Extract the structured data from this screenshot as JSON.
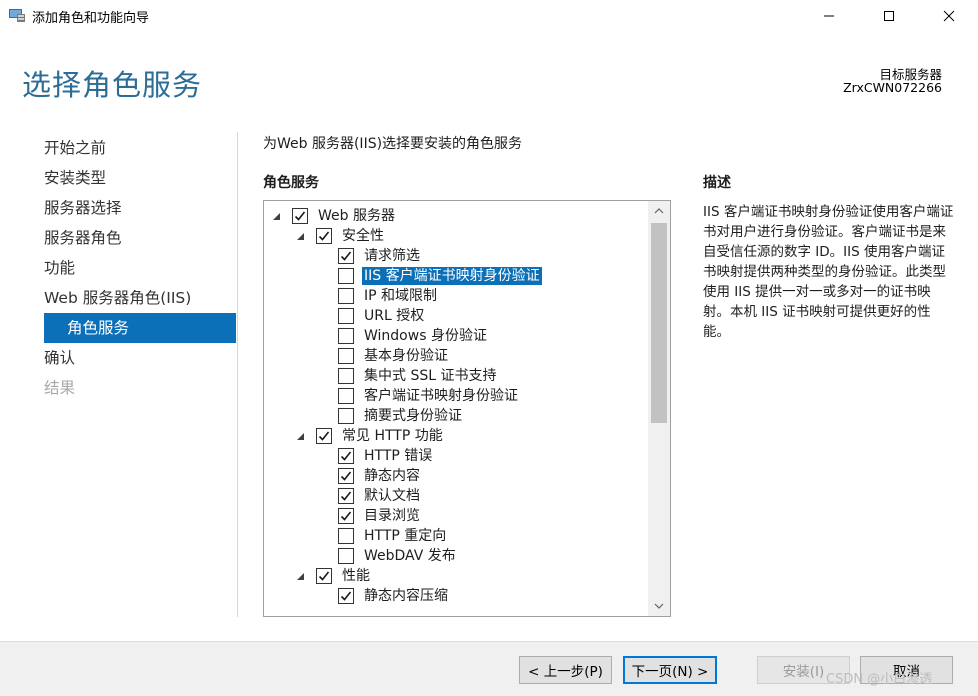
{
  "window": {
    "title": "添加角色和功能向导",
    "icons": {
      "app": "server-manager-icon",
      "minimize": "minimize-icon",
      "maximize": "maximize-icon",
      "close": "close-icon"
    }
  },
  "header": {
    "page_title": "选择角色服务",
    "destination_label": "目标服务器",
    "destination_server": "ZrxCWN072266"
  },
  "nav": {
    "items": [
      {
        "label": "开始之前",
        "state": "normal"
      },
      {
        "label": "安装类型",
        "state": "normal"
      },
      {
        "label": "服务器选择",
        "state": "normal"
      },
      {
        "label": "服务器角色",
        "state": "normal"
      },
      {
        "label": "功能",
        "state": "normal"
      },
      {
        "label": "Web 服务器角色(IIS)",
        "state": "normal"
      },
      {
        "label": "角色服务",
        "state": "active"
      },
      {
        "label": "确认",
        "state": "normal"
      },
      {
        "label": "结果",
        "state": "disabled"
      }
    ]
  },
  "content": {
    "instruction": "为Web 服务器(IIS)选择要安装的角色服务",
    "section_heading": "角色服务",
    "tree": [
      {
        "label": "Web 服务器",
        "level": 0,
        "expandable": true,
        "checked": true
      },
      {
        "label": "安全性",
        "level": 1,
        "expandable": true,
        "checked": true
      },
      {
        "label": "请求筛选",
        "level": 2,
        "checked": true
      },
      {
        "label": "IIS 客户端证书映射身份验证",
        "level": 2,
        "checked": false,
        "selected": true
      },
      {
        "label": "IP 和域限制",
        "level": 2,
        "checked": false
      },
      {
        "label": "URL 授权",
        "level": 2,
        "checked": false
      },
      {
        "label": "Windows 身份验证",
        "level": 2,
        "checked": false
      },
      {
        "label": "基本身份验证",
        "level": 2,
        "checked": false
      },
      {
        "label": "集中式 SSL 证书支持",
        "level": 2,
        "checked": false
      },
      {
        "label": "客户端证书映射身份验证",
        "level": 2,
        "checked": false
      },
      {
        "label": "摘要式身份验证",
        "level": 2,
        "checked": false
      },
      {
        "label": "常见 HTTP 功能",
        "level": 1,
        "expandable": true,
        "checked": true
      },
      {
        "label": "HTTP 错误",
        "level": 2,
        "checked": true
      },
      {
        "label": "静态内容",
        "level": 2,
        "checked": true
      },
      {
        "label": "默认文档",
        "level": 2,
        "checked": true
      },
      {
        "label": "目录浏览",
        "level": 2,
        "checked": true
      },
      {
        "label": "HTTP 重定向",
        "level": 2,
        "checked": false
      },
      {
        "label": "WebDAV 发布",
        "level": 2,
        "checked": false
      },
      {
        "label": "性能",
        "level": 1,
        "expandable": true,
        "checked": true
      },
      {
        "label": "静态内容压缩",
        "level": 2,
        "checked": true
      }
    ],
    "scroll_position": 0
  },
  "description": {
    "heading": "描述",
    "text": "IIS 客户端证书映射身份验证使用客户端证书对用户进行身份验证。客户端证书是来自受信任源的数字 ID。IIS 使用客户端证书映射提供两种类型的身份验证。此类型使用 IIS 提供一对一或多对一的证书映射。本机 IIS 证书映射可提供更好的性能。"
  },
  "footer": {
    "prev_label": "< 上一步(P)",
    "next_label": "下一页(N) >",
    "install_label": "安装(I)",
    "cancel_label": "取消",
    "watermark": "CSDN @小白渗透"
  },
  "colors": {
    "accent": "#0b70b8",
    "title": "#2b6d97",
    "disabled_text": "#a9a9a9"
  }
}
